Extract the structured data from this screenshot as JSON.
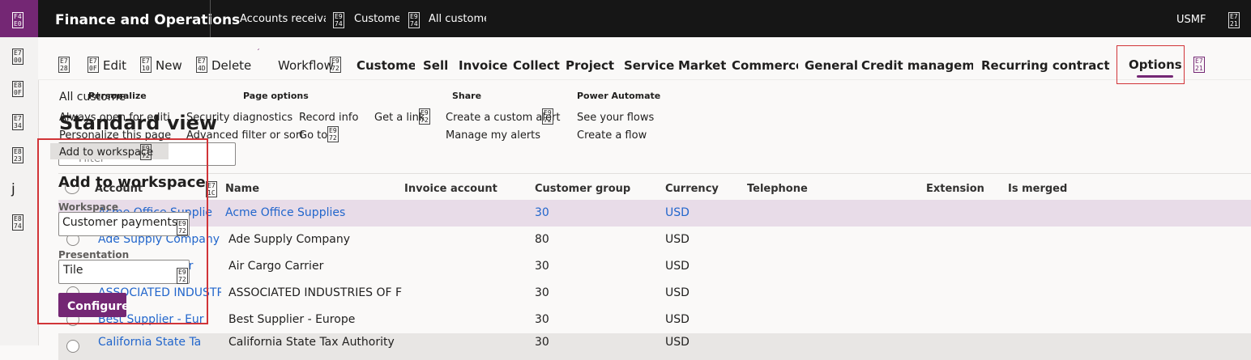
{
  "topbar": {
    "logo_icon": "app-launcher-icon",
    "app_title": "Finance and Operations",
    "breadcrumb": [
      "Accounts receival",
      "Customer",
      "All custome"
    ],
    "company": "USMF",
    "settings_icon": "settings-icon"
  },
  "leftrail": {
    "icons": [
      "home-icon",
      "favorites-icon",
      "recent-icon",
      "workspaces-icon",
      "j-icon",
      "modules-icon"
    ],
    "j_glyph": "j"
  },
  "actionpane": {
    "actions": [
      "Edit",
      "New",
      "Delete",
      "Workflow"
    ],
    "tabs": [
      "Customer",
      "Sell",
      "Invoice",
      "Collect",
      "Projects",
      "Service",
      "Market",
      "Commerce",
      "General",
      "Credit manageme",
      "Recurring contract bil",
      "Options"
    ],
    "selected_tab": "Options"
  },
  "page": {
    "subtitle": "All custome",
    "title": "Standard view",
    "filter_placeholder": "Filter"
  },
  "options_menu": {
    "groups": [
      {
        "name": "Personalize",
        "items": [
          "Always open for editin",
          "Personalize this page",
          "Add to workspace"
        ]
      },
      {
        "name": "Page options",
        "items": [
          "Security diagnostics",
          "Advanced filter or sort",
          "Record info",
          "Go to",
          "Get a link"
        ]
      },
      {
        "name": "Share",
        "items": [
          "Create a custom alert",
          "Manage my alerts"
        ]
      },
      {
        "name": "Power Automate",
        "items": [
          "See your flows",
          "Create a flow"
        ]
      }
    ]
  },
  "workspace_panel": {
    "title": "Add to workspace",
    "workspace_label": "Workspace",
    "workspace_value": "Customer payments",
    "presentation_label": "Presentation",
    "presentation_value": "Tile",
    "configure_label": "Configure"
  },
  "grid": {
    "columns": [
      "Account",
      "Name",
      "Invoice account",
      "Customer group",
      "Currency",
      "Telephone",
      "Extension",
      "Is merged"
    ],
    "rows": [
      {
        "account": "Acme Office Supplie",
        "name": "Acme Office Supplies",
        "group": "30",
        "currency": "USD"
      },
      {
        "account": "Ade Supply Company",
        "name": "Ade Supply Company",
        "group": "80",
        "currency": "USD"
      },
      {
        "account": "Air Cargo Carrier",
        "name": "Air Cargo Carrier",
        "group": "30",
        "currency": "USD"
      },
      {
        "account": "ASSOCIATED INDUSTR",
        "name": "ASSOCIATED INDUSTRIES OF F",
        "group": "30",
        "currency": "USD"
      },
      {
        "account": "Best Supplier - Eur",
        "name": "Best Supplier - Europe",
        "group": "30",
        "currency": "USD"
      },
      {
        "account": "California State Ta",
        "name": "California State Tax Authority",
        "group": "30",
        "currency": "USD"
      }
    ]
  },
  "colors": {
    "brand": "#742774",
    "topbar": "#161616",
    "link": "#2266cc",
    "highlight": "#d13438",
    "selected_row": "#e8dce8"
  }
}
